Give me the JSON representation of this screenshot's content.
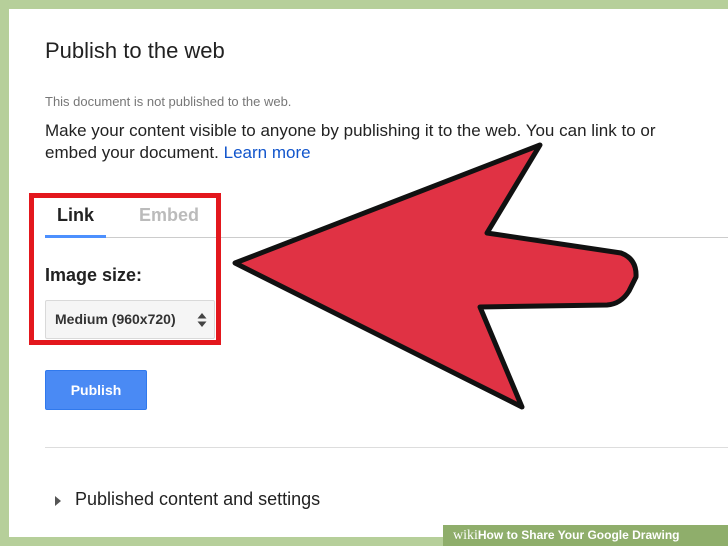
{
  "dialog": {
    "title": "Publish to the web",
    "status": "This document is not published to the web.",
    "description_line1": "Make your content visible to anyone by publishing it to the web. You can link to or",
    "description_line2": "embed your document.",
    "learn_more": "Learn more"
  },
  "tabs": [
    {
      "label": "Link",
      "active": true
    },
    {
      "label": "Embed",
      "active": false
    }
  ],
  "image_size": {
    "label": "Image size:",
    "selected": "Medium (960x720)"
  },
  "publish_button": {
    "label": "Publish"
  },
  "published_section": {
    "label": "Published content and settings"
  },
  "watermark": {
    "brand_wiki": "wiki",
    "brand_how": "How",
    "text": " to Share Your Google Drawing"
  },
  "colors": {
    "accent_blue": "#4a8af4",
    "link_blue": "#1155cc",
    "highlight_red": "#e3171d",
    "arrow_red": "#e03244",
    "background_green": "#b6cf9a"
  },
  "icons": {
    "select": "sort-up-down-icon",
    "expand": "triangle-right-icon",
    "overlay": "red-arrow-pointer"
  }
}
